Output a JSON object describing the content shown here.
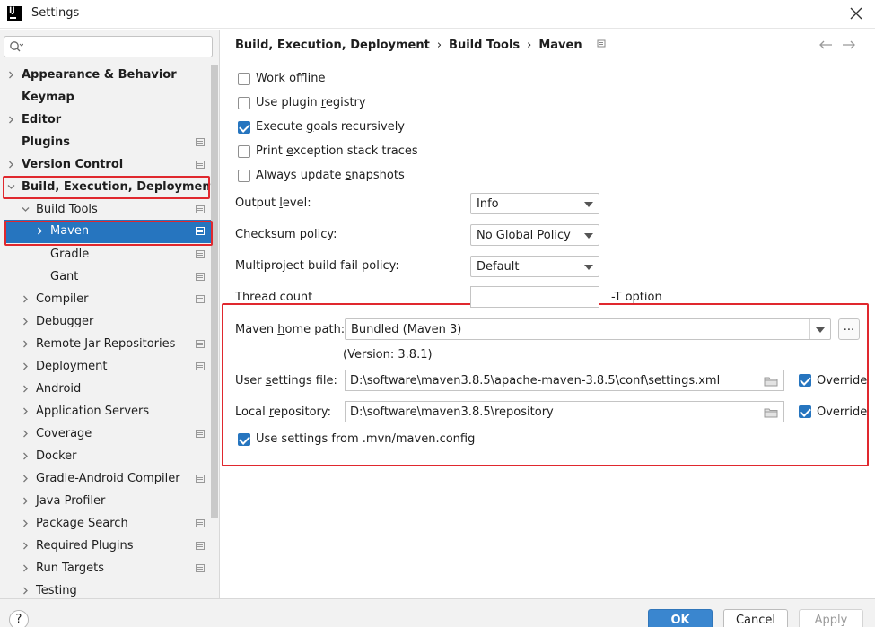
{
  "window": {
    "title": "Settings",
    "app_logo_text": "IJ"
  },
  "search": {
    "value": "",
    "placeholder": ""
  },
  "sidebar": {
    "items": [
      {
        "label": "Appearance & Behavior",
        "bold": true,
        "chevron": "right",
        "project": false
      },
      {
        "label": "Keymap",
        "bold": true,
        "chevron": "none",
        "project": false
      },
      {
        "label": "Editor",
        "bold": true,
        "chevron": "right",
        "project": false
      },
      {
        "label": "Plugins",
        "bold": true,
        "chevron": "none",
        "project": true
      },
      {
        "label": "Version Control",
        "bold": true,
        "chevron": "right",
        "project": true
      },
      {
        "label": "Build, Execution, Deployment",
        "bold": true,
        "chevron": "down",
        "project": false
      },
      {
        "label": "Build Tools",
        "bold": false,
        "chevron": "down",
        "project": true
      },
      {
        "label": "Maven",
        "bold": false,
        "chevron": "right",
        "project": true,
        "selected": true
      },
      {
        "label": "Gradle",
        "bold": false,
        "chevron": "none",
        "project": true
      },
      {
        "label": "Gant",
        "bold": false,
        "chevron": "none",
        "project": true
      },
      {
        "label": "Compiler",
        "bold": false,
        "chevron": "right",
        "project": true
      },
      {
        "label": "Debugger",
        "bold": false,
        "chevron": "right",
        "project": false
      },
      {
        "label": "Remote Jar Repositories",
        "bold": false,
        "chevron": "right",
        "project": true
      },
      {
        "label": "Deployment",
        "bold": false,
        "chevron": "right",
        "project": true
      },
      {
        "label": "Android",
        "bold": false,
        "chevron": "right",
        "project": false
      },
      {
        "label": "Application Servers",
        "bold": false,
        "chevron": "right",
        "project": false
      },
      {
        "label": "Coverage",
        "bold": false,
        "chevron": "right",
        "project": true
      },
      {
        "label": "Docker",
        "bold": false,
        "chevron": "right",
        "project": false
      },
      {
        "label": "Gradle-Android Compiler",
        "bold": false,
        "chevron": "right",
        "project": true
      },
      {
        "label": "Java Profiler",
        "bold": false,
        "chevron": "right",
        "project": false
      },
      {
        "label": "Package Search",
        "bold": false,
        "chevron": "right",
        "project": true
      },
      {
        "label": "Required Plugins",
        "bold": false,
        "chevron": "right",
        "project": true
      },
      {
        "label": "Run Targets",
        "bold": false,
        "chevron": "right",
        "project": true
      },
      {
        "label": "Testing",
        "bold": false,
        "chevron": "right",
        "project": false
      }
    ]
  },
  "breadcrumb": {
    "items": [
      "Build, Execution, Deployment",
      "Build Tools",
      "Maven"
    ],
    "separator": "›"
  },
  "options": {
    "work_offline": {
      "pre": "Work ",
      "u": "o",
      "post": "ffline",
      "checked": false
    },
    "use_plugin_registry": {
      "pre": "Use plugin ",
      "u": "r",
      "post": "egistry",
      "checked": false
    },
    "execute_goals_recursively": {
      "pre": "Execute ",
      "u": "g",
      "post": "oals recursively",
      "checked": true
    },
    "print_exception": {
      "pre": "Print ",
      "u": "e",
      "post": "xception stack traces",
      "checked": false
    },
    "always_update": {
      "pre": "Always update ",
      "u": "s",
      "post": "napshots",
      "checked": false
    }
  },
  "output_level": {
    "pre": "Output ",
    "u": "l",
    "post": "evel:",
    "value": "Info"
  },
  "checksum_policy": {
    "pre": "",
    "u": "C",
    "post": "hecksum policy:",
    "value": "No Global Policy"
  },
  "multiproject_policy": {
    "label": "Multiproject build fail policy:",
    "value": "Default"
  },
  "thread_count": {
    "label": "Thread count",
    "value": "",
    "hint": "-T option"
  },
  "maven_home": {
    "pre": "Maven ",
    "u": "h",
    "post": "ome path:",
    "value": "Bundled (Maven 3)",
    "version": "(Version: 3.8.1)",
    "browse_label": "..."
  },
  "user_settings": {
    "pre": "User ",
    "u": "s",
    "post": "ettings file:",
    "value": "D:\\software\\maven3.8.5\\apache-maven-3.8.5\\conf\\settings.xml",
    "override_label": "Override",
    "override_checked": true
  },
  "local_repo": {
    "pre": "Local ",
    "u": "r",
    "post": "epository:",
    "value": "D:\\software\\maven3.8.5\\repository",
    "override_label": "Override",
    "override_checked": true
  },
  "use_mvn_config": {
    "label": "Use settings from .mvn/maven.config",
    "checked": true
  },
  "footer": {
    "help_label": "?",
    "ok_label": "OK",
    "cancel_label": "Cancel",
    "apply_label": "Apply"
  },
  "colors": {
    "accent": "#2675bf",
    "highlight_box": "#e0282e",
    "ok_button": "#3a86cf"
  }
}
